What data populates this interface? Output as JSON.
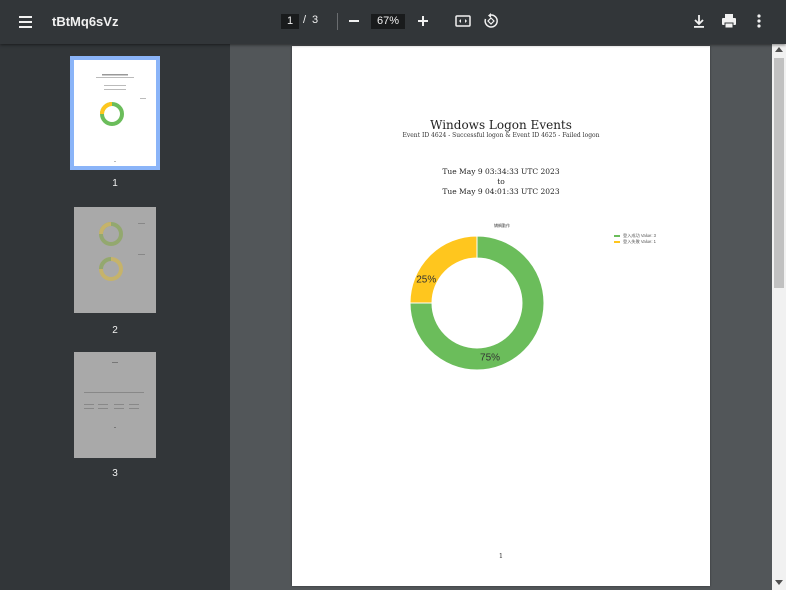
{
  "toolbar": {
    "title": "tBtMq6sVz",
    "current_page": "1",
    "page_separator": "/",
    "total_pages": "3",
    "zoom": "67%"
  },
  "thumbnails": [
    {
      "label": "1"
    },
    {
      "label": "2"
    },
    {
      "label": "3"
    }
  ],
  "page": {
    "heading": "Windows Logon Events",
    "subtitle": "Event ID 4624 - Successful logon & Event ID 4625 - Failed logon",
    "start_time": "Tue May 9 03:34:33 UTC 2023",
    "to_word": "to",
    "end_time": "Tue May 9 04:01:33 UTC 2023",
    "page_number": "1"
  },
  "colors": {
    "success": "#6bbd5b",
    "failed": "#ffc61e",
    "toolbar_bg": "#323639",
    "viewer_bg": "#525659",
    "selection": "#8ab4f8"
  },
  "chart_data": {
    "type": "pie",
    "title": "矯綢勤作",
    "categories": [
      "登入成功",
      "登入失敗"
    ],
    "values": [
      3,
      1
    ],
    "percent_labels": [
      "75%",
      "25%"
    ],
    "legend_labels": [
      "登入成功  Value: 3",
      "登入失敗  Value: 1"
    ],
    "legend_position": "right",
    "donut": true
  }
}
